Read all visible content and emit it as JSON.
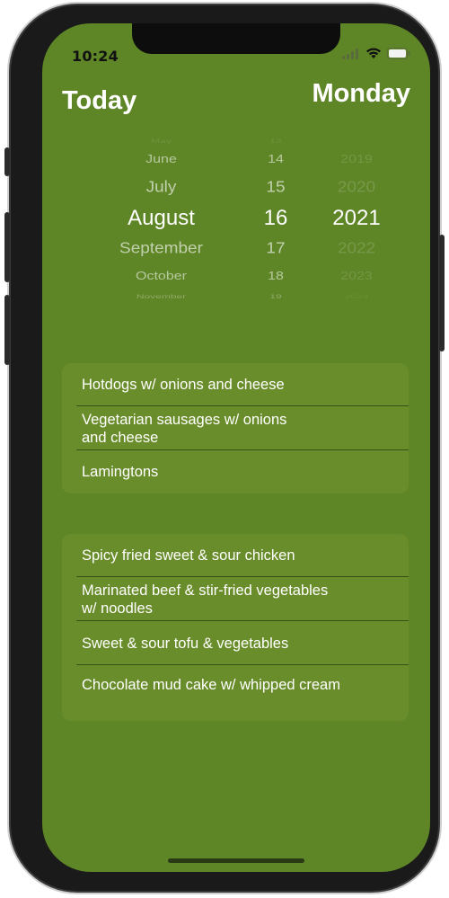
{
  "status_bar": {
    "time": "10:24",
    "icons": [
      "signal-icon",
      "wifi-icon",
      "battery-icon"
    ]
  },
  "header": {
    "left_title": "Today",
    "right_title": "Monday"
  },
  "date_picker": {
    "months": [
      "May",
      "June",
      "July",
      "August",
      "September",
      "October",
      "November"
    ],
    "days": [
      "13",
      "14",
      "15",
      "16",
      "17",
      "18",
      "19"
    ],
    "years": [
      "2018",
      "2019",
      "2020",
      "2021",
      "2022",
      "2023",
      "2024"
    ],
    "selected": {
      "month": "August",
      "day": "16",
      "year": "2021"
    }
  },
  "menu_groups": [
    {
      "items": [
        [
          "Hotdogs w/ onions and cheese"
        ],
        [
          "Vegetarian sausages w/ onions",
          "and cheese"
        ],
        [
          "Lamingtons"
        ]
      ]
    },
    {
      "items": [
        [
          "Spicy fried sweet & sour chicken"
        ],
        [
          "Marinated beef & stir-fried vegetables",
          "w/ noodles"
        ],
        [
          "Sweet & sour tofu & vegetables"
        ],
        [
          "Chocolate mud cake w/ whipped cream"
        ]
      ]
    }
  ],
  "colors": {
    "background": "#5e8526",
    "card": "#6a8d2b",
    "text": "#ffffff"
  }
}
